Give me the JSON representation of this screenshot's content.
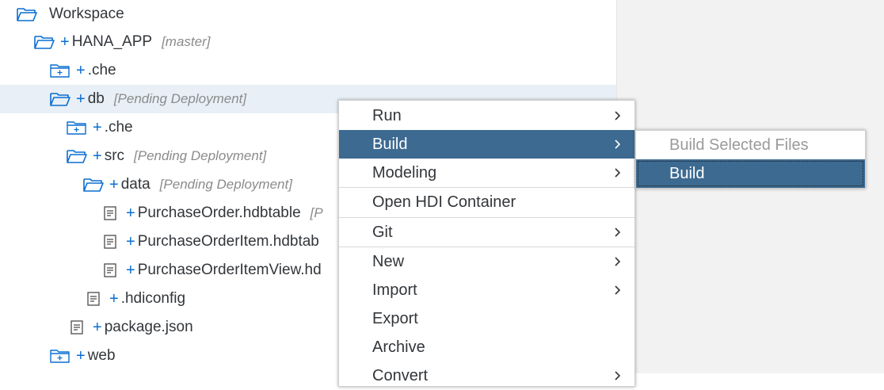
{
  "tree": {
    "rows": [
      {
        "name": "Workspace",
        "icon": "folder-open-icon",
        "tag": "",
        "plus": ""
      },
      {
        "name": "HANA_APP",
        "icon": "folder-open-icon",
        "tag": "[master]",
        "plus": "+"
      },
      {
        "name": ".che",
        "icon": "folder-closed-plus-icon",
        "tag": "",
        "plus": "+"
      },
      {
        "name": "db",
        "icon": "folder-open-icon",
        "tag": "[Pending Deployment]",
        "plus": "+"
      },
      {
        "name": ".che",
        "icon": "folder-closed-plus-icon",
        "tag": "",
        "plus": "+"
      },
      {
        "name": "src",
        "icon": "folder-open-icon",
        "tag": "[Pending Deployment]",
        "plus": "+"
      },
      {
        "name": "data",
        "icon": "folder-open-icon",
        "tag": "[Pending Deployment]",
        "plus": "+"
      },
      {
        "name": "PurchaseOrder.hdbtable",
        "icon": "file-icon",
        "tag": "[P",
        "plus": "+"
      },
      {
        "name": "PurchaseOrderItem.hdbtab",
        "icon": "file-icon",
        "tag": "",
        "plus": "+"
      },
      {
        "name": "PurchaseOrderItemView.hd",
        "icon": "file-icon",
        "tag": "",
        "plus": "+"
      },
      {
        "name": ".hdiconfig",
        "icon": "file-icon",
        "tag": "",
        "plus": "+"
      },
      {
        "name": "package.json",
        "icon": "file-icon",
        "tag": "",
        "plus": "+"
      },
      {
        "name": "web",
        "icon": "folder-closed-plus-icon",
        "tag": "",
        "plus": "+"
      }
    ]
  },
  "context_menu": {
    "items": [
      {
        "label": "Run",
        "submenu": true
      },
      {
        "label": "Build",
        "submenu": true
      },
      {
        "label": "Modeling",
        "submenu": true
      },
      {
        "label": "Open HDI Container",
        "submenu": false
      },
      {
        "label": "Git",
        "submenu": true
      },
      {
        "label": "New",
        "submenu": true
      },
      {
        "label": "Import",
        "submenu": true
      },
      {
        "label": "Export",
        "submenu": false
      },
      {
        "label": "Archive",
        "submenu": false
      },
      {
        "label": "Convert",
        "submenu": true
      }
    ]
  },
  "build_submenu": {
    "items": [
      {
        "label": "Build Selected Files",
        "state": "disabled"
      },
      {
        "label": "Build",
        "state": "active"
      }
    ]
  },
  "colors": {
    "accent": "#0a6ed1",
    "menu_highlight": "#3d6a91",
    "selected_row": "#e8eff6"
  }
}
